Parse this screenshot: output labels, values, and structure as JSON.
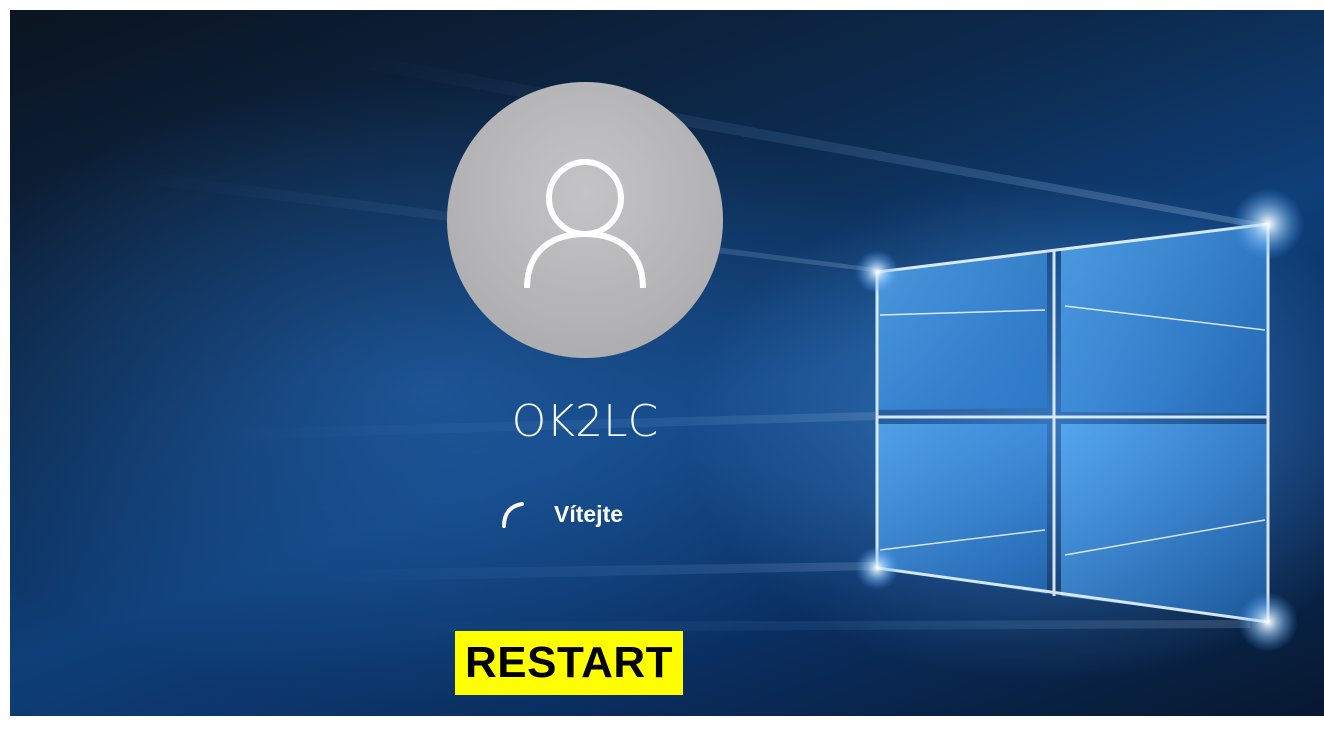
{
  "login": {
    "username": "OK2LC",
    "status": "Vítejte",
    "avatar_icon": "user-silhouette-icon",
    "spinner_icon": "loading-spinner-icon"
  },
  "overlay": {
    "label": "RESTART",
    "background_color": "#ffff00"
  },
  "wallpaper": {
    "logo": "windows-10-logo",
    "accent_color": "#3a8ee6"
  }
}
